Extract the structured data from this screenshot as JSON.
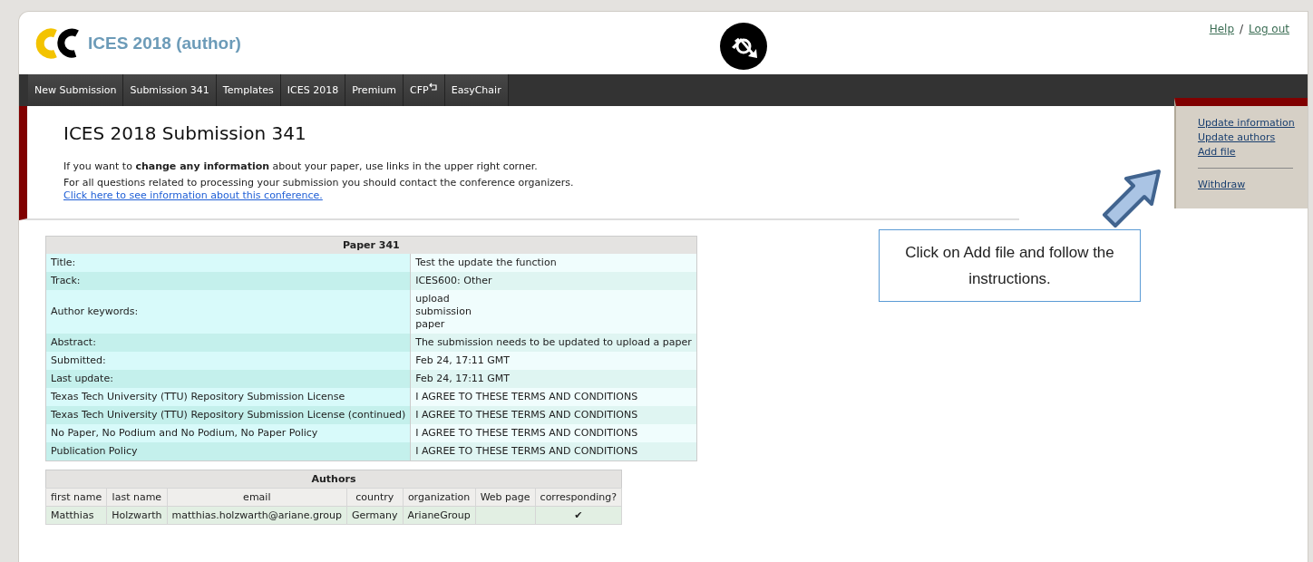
{
  "header": {
    "title": "ICES 2018 (author)",
    "links": [
      "Help",
      "Log out"
    ],
    "link_separator": "/"
  },
  "nav": [
    {
      "label": "New Submission",
      "selected": false
    },
    {
      "label": "Submission 341",
      "selected": false
    },
    {
      "label": "Templates",
      "selected": false
    },
    {
      "label": "ICES 2018",
      "selected": false
    },
    {
      "label": "Premium",
      "selected": false
    },
    {
      "label": "CFP",
      "selected": false,
      "icon": true
    },
    {
      "label": "EasyChair",
      "selected": false
    }
  ],
  "page": {
    "heading": "ICES 2018 Submission 341",
    "paragraphs": [
      {
        "text": "If you want to **change any information** about your paper, use links in the upper right corner."
      },
      {
        "text": "For all questions related to processing your submission you should contact the conference organizers.",
        "link": "Click here to see information about this conference."
      }
    ]
  },
  "side_menu": {
    "links": [
      "Update information",
      "Update authors",
      "Add file"
    ],
    "bottom_links": [
      "Withdraw"
    ]
  },
  "callout": {
    "text": "Click on Add file and follow the instructions."
  },
  "paper_table": {
    "title": "Paper 341",
    "rows": [
      {
        "label": "Title:",
        "lines": [
          "Test the update the function"
        ]
      },
      {
        "label": "Track:",
        "lines": [
          "ICES600: Other"
        ]
      },
      {
        "label": "Author keywords:",
        "lines": [
          "upload",
          "submission",
          "paper"
        ]
      },
      {
        "label": "Abstract:",
        "lines": [
          "The submission needs to be updated to upload a paper"
        ]
      },
      {
        "label": "Submitted:",
        "lines": [
          "Feb 24, 17:11 GMT"
        ]
      },
      {
        "label": "Last update:",
        "lines": [
          "Feb 24, 17:11 GMT"
        ]
      },
      {
        "label": "Texas Tech University (TTU) Repository Submission License",
        "lines": [
          "I AGREE TO THESE TERMS AND CONDITIONS"
        ]
      },
      {
        "label": "Texas Tech University (TTU) Repository Submission License (continued)",
        "lines": [
          "I AGREE TO THESE TERMS AND CONDITIONS"
        ]
      },
      {
        "label": "No Paper, No Podium and No Podium, No Paper Policy",
        "lines": [
          "I AGREE TO THESE TERMS AND CONDITIONS"
        ]
      },
      {
        "label": "Publication Policy",
        "lines": [
          "I AGREE TO THESE TERMS AND CONDITIONS"
        ]
      }
    ]
  },
  "authors_table": {
    "title": "Authors",
    "columns": [
      "first name",
      "last name",
      "email",
      "country",
      "organization",
      "Web page",
      "corresponding?"
    ],
    "rows": [
      [
        "Matthias",
        "Holzwarth",
        "matthias.holzwarth@ariane.group",
        "Germany",
        "ArianeGroup",
        "",
        "✔"
      ]
    ]
  }
}
